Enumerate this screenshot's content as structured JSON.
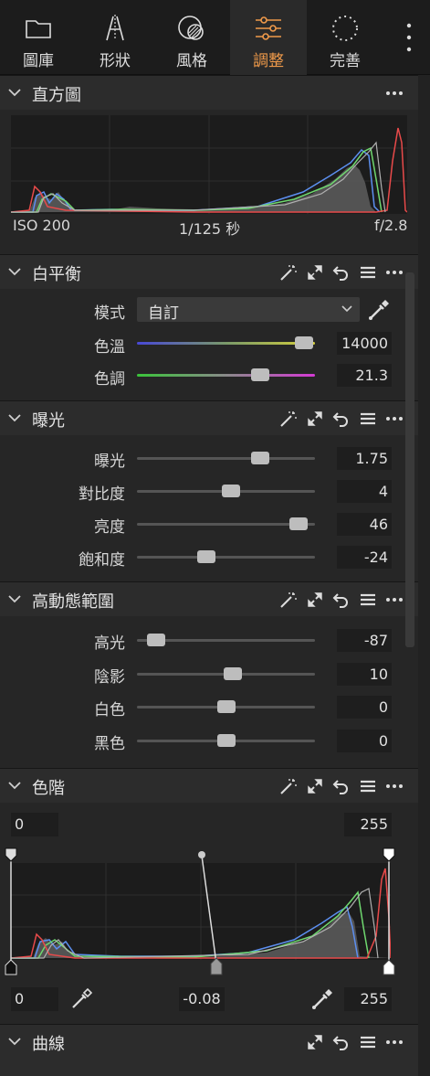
{
  "tabs": [
    {
      "label": "圖庫",
      "icon": "folder-icon"
    },
    {
      "label": "形狀",
      "icon": "shape-icon"
    },
    {
      "label": "風格",
      "icon": "style-icon"
    },
    {
      "label": "調整",
      "icon": "sliders-icon",
      "active": true
    },
    {
      "label": "完善",
      "icon": "refine-icon"
    }
  ],
  "histogram": {
    "title": "直方圖",
    "iso": "ISO 200",
    "shutter": "1/125 秒",
    "aperture": "f/2.8"
  },
  "white_balance": {
    "title": "白平衡",
    "mode_label": "模式",
    "mode_value": "自訂",
    "temp_label": "色溫",
    "temp_value": "14000",
    "temp_level": 0.94,
    "tint_label": "色調",
    "tint_value": "21.3",
    "tint_level": 0.69
  },
  "exposure": {
    "title": "曝光",
    "rows": [
      {
        "label": "曝光",
        "value": "1.75",
        "level": 0.69
      },
      {
        "label": "對比度",
        "value": "4",
        "level": 0.53
      },
      {
        "label": "亮度",
        "value": "46",
        "level": 0.91
      },
      {
        "label": "飽和度",
        "value": "-24",
        "level": 0.39
      }
    ]
  },
  "hdr": {
    "title": "高動態範圍",
    "rows": [
      {
        "label": "高光",
        "value": "-87",
        "level": 0.11
      },
      {
        "label": "陰影",
        "value": "10",
        "level": 0.54
      },
      {
        "label": "白色",
        "value": "0",
        "level": 0.5
      },
      {
        "label": "黑色",
        "value": "0",
        "level": 0.5
      }
    ]
  },
  "levels": {
    "title": "色階",
    "input_low": "0",
    "input_high": "255",
    "output_low": "0",
    "midpoint": "-0.08",
    "output_high": "255"
  },
  "curves": {
    "title": "曲線"
  },
  "colors": {
    "accent": "#f09a4a",
    "panel": "#262626",
    "header": "#2c2c2c"
  }
}
